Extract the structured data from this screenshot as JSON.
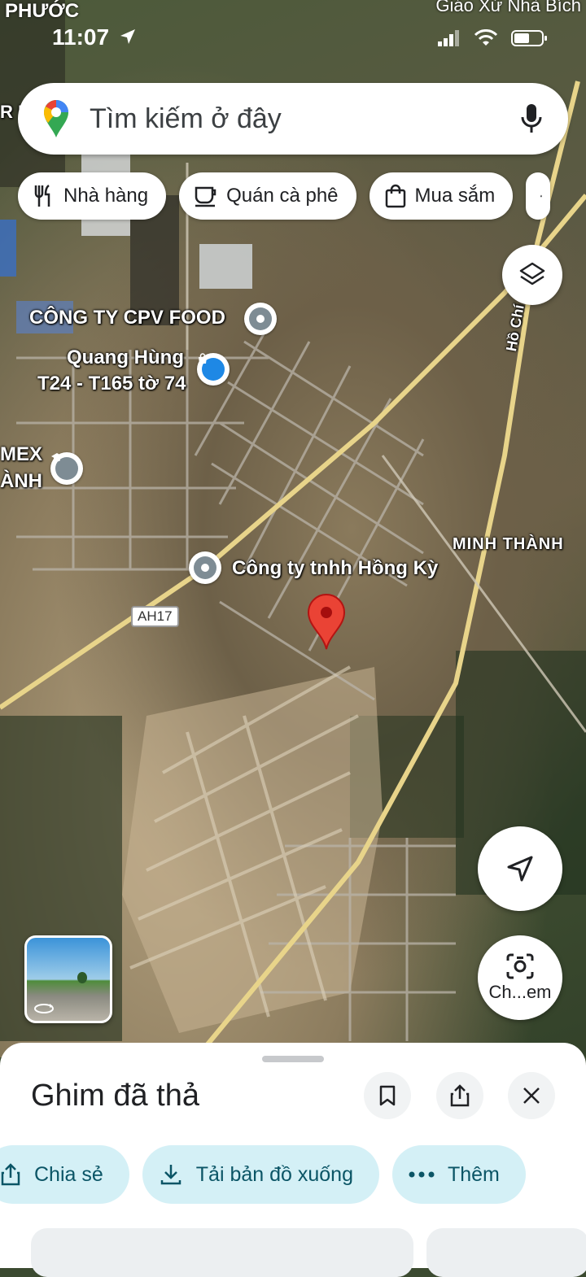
{
  "status_bar": {
    "time": "11:07",
    "place_left": "PHƯỚC",
    "place_right": "Giáo Xứ Nhà Bích"
  },
  "search": {
    "placeholder": "Tìm kiếm ở đây"
  },
  "chips": [
    {
      "label": "Nhà hàng",
      "icon": "restaurant-icon"
    },
    {
      "label": "Quán cà phê",
      "icon": "coffee-icon"
    },
    {
      "label": "Mua sắm",
      "icon": "shopping-bag-icon"
    }
  ],
  "map": {
    "labels": {
      "cpv_food": "CÔNG TY CPV FOOD",
      "quang_hung_1": "Quang Hùng",
      "quang_hung_2": "T24 - T165 tờ 74",
      "mex_1": "MEX",
      "mex_2": "ÀNH",
      "minh_thanh": "MINH THÀNH",
      "hong_ky": "Công ty tnhh Hồng Kỳ",
      "ah17": "AH17",
      "road_ho_chi_minh": "Hồ Chí",
      "edge_left": "R P"
    }
  },
  "buttons": {
    "camera_label": "Ch...em"
  },
  "sheet": {
    "title": "Ghim đã thả",
    "actions": [
      {
        "label": "Chia sẻ",
        "icon": "share-icon"
      },
      {
        "label": "Tải bản đồ xuống",
        "icon": "download-icon"
      },
      {
        "label": "Thêm",
        "icon": "more-dots-icon"
      }
    ]
  },
  "colors": {
    "accent_pill_bg": "#d4f0f6",
    "accent_pill_text": "#0b5566",
    "pin_red": "#ea4335"
  }
}
